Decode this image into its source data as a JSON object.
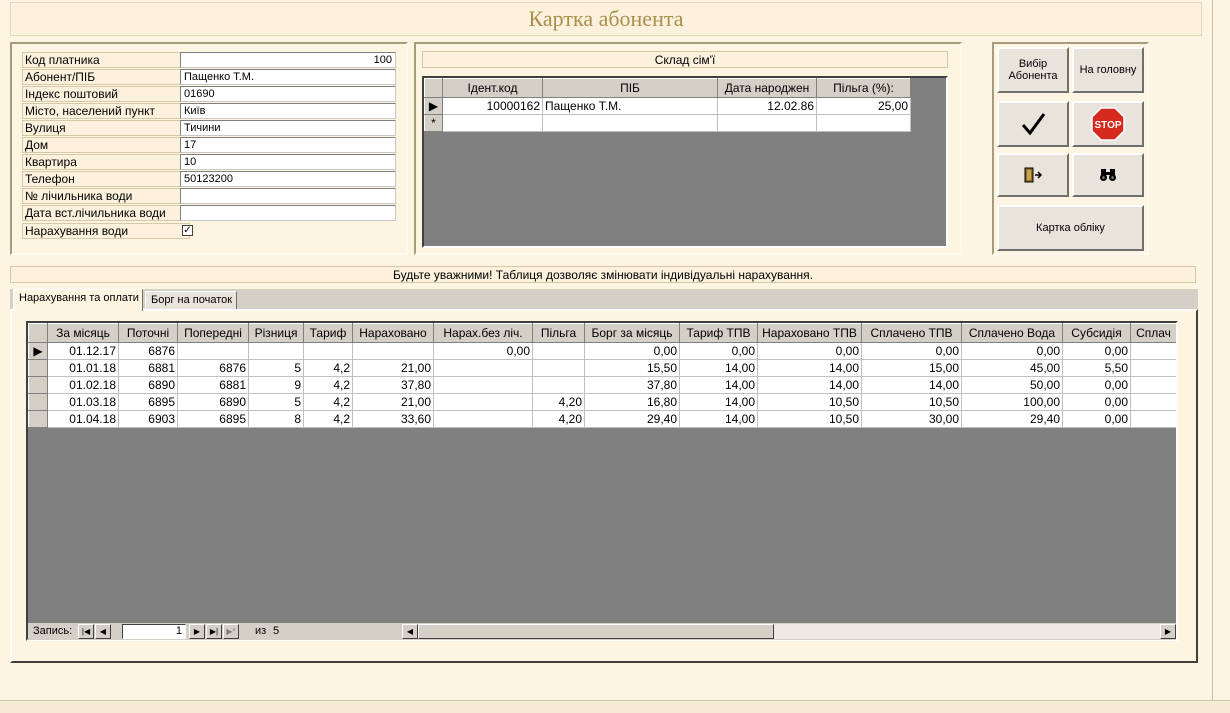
{
  "title": "Картка абонента",
  "subscriber": {
    "fields": [
      {
        "label": "Код платника",
        "value": "100",
        "align": "right"
      },
      {
        "label": "Абонент/ПІБ",
        "value": "Пащенко Т.М."
      },
      {
        "label": "Індекс поштовий",
        "value": "01690"
      },
      {
        "label": "Місто, населений пункт",
        "value": "Київ"
      },
      {
        "label": "Вулиця",
        "value": "Тичини"
      },
      {
        "label": "Дом",
        "value": "17"
      },
      {
        "label": "Квартира",
        "value": "10"
      },
      {
        "label": "Телефон",
        "value": "50123200"
      },
      {
        "label": "№ лічильника води",
        "value": ""
      },
      {
        "label": "Дата вст.лічильника води",
        "value": ""
      }
    ],
    "water_charge_label": "Нарахування води",
    "water_charge_checked": true
  },
  "family": {
    "header": "Склад сім'ї",
    "columns": [
      "Ідент.код",
      "ПІБ",
      "Дата народжен",
      "Пільга (%):"
    ],
    "rows": [
      [
        "10000162",
        "Пащенко Т.М.",
        "12.02.86",
        "25,00"
      ]
    ]
  },
  "buttons": {
    "select_subscriber": "Вибір Абонента",
    "home": "На головну",
    "card": "Картка обліку"
  },
  "icons": {
    "confirm": "checkmark-icon",
    "stop": "stop-icon",
    "exit": "exit-door-icon",
    "find": "binoculars-icon"
  },
  "colors": {
    "stop_red": "#d42a1e",
    "title": "#a8904a"
  },
  "warning": "Будьте уважними! Таблиця дозволяє змінювати індивідуальні нарахування.",
  "tabs": [
    {
      "label": "Нарахування та оплати",
      "active": true
    },
    {
      "label": "Борг на початок",
      "active": false
    }
  ],
  "charges": {
    "columns": [
      "За місяць",
      "Поточні",
      "Попередні",
      "Різниця",
      "Тариф",
      "Нараховано",
      "Нарах.без ліч.",
      "Пільга",
      "Борг за місяць",
      "Тариф ТПВ",
      "Нараховано ТПВ",
      "Сплачено ТПВ",
      "Сплачено Вода",
      "Субсидія",
      "Сплач"
    ],
    "rows": [
      [
        "01.12.17",
        "6876",
        "",
        "",
        "",
        "",
        "0,00",
        "",
        "0,00",
        "0,00",
        "0,00",
        "0,00",
        "0,00",
        "0,00",
        ""
      ],
      [
        "01.01.18",
        "6881",
        "6876",
        "5",
        "4,2",
        "21,00",
        "",
        "",
        "15,50",
        "14,00",
        "14,00",
        "15,00",
        "45,00",
        "5,50",
        ""
      ],
      [
        "01.02.18",
        "6890",
        "6881",
        "9",
        "4,2",
        "37,80",
        "",
        "",
        "37,80",
        "14,00",
        "14,00",
        "14,00",
        "50,00",
        "0,00",
        ""
      ],
      [
        "01.03.18",
        "6895",
        "6890",
        "5",
        "4,2",
        "21,00",
        "",
        "4,20",
        "16,80",
        "14,00",
        "10,50",
        "10,50",
        "100,00",
        "0,00",
        ""
      ],
      [
        "01.04.18",
        "6903",
        "6895",
        "8",
        "4,2",
        "33,60",
        "",
        "4,20",
        "29,40",
        "14,00",
        "10,50",
        "30,00",
        "29,40",
        "0,00",
        ""
      ]
    ]
  },
  "navigation": {
    "record_label": "Запись:",
    "current": "1",
    "of_label": "из",
    "total": "5"
  }
}
